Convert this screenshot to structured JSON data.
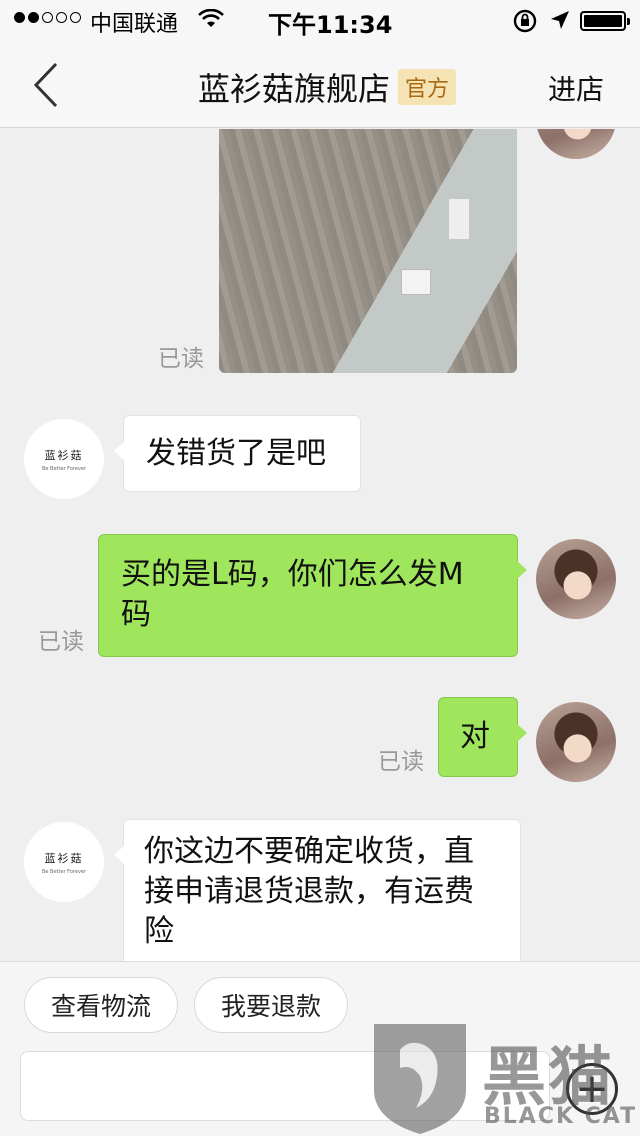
{
  "status_bar": {
    "carrier": "中国联通",
    "time": "下午11:34"
  },
  "nav": {
    "title": "蓝衫菇旗舰店",
    "badge": "官方",
    "enter_store": "进店"
  },
  "store_logo": {
    "name": "蓝衫菇",
    "slogan": "Be Better Forever"
  },
  "messages": [
    {
      "side": "out",
      "type": "image",
      "read": "已读"
    },
    {
      "side": "in",
      "text": "发错货了是吧"
    },
    {
      "side": "out",
      "line1": "买的是L码，你们怎么发M",
      "line2": "码",
      "read": "已读"
    },
    {
      "side": "out",
      "text": "对",
      "read": "已读"
    },
    {
      "side": "in",
      "line1": "你这边不要确定收货，直",
      "line2": "接申请退货退款，有运费",
      "line3": "险"
    }
  ],
  "quick_replies": [
    "查看物流",
    "我要退款"
  ],
  "input": {
    "placeholder": ""
  },
  "watermark": {
    "cn": "黑猫",
    "en": "BLACK CAT"
  },
  "colors": {
    "out_bubble": "#9fe65c",
    "in_bubble": "#ffffff",
    "background": "#efefef",
    "badge_bg": "#f5e3b3",
    "badge_text": "#a86a12"
  }
}
